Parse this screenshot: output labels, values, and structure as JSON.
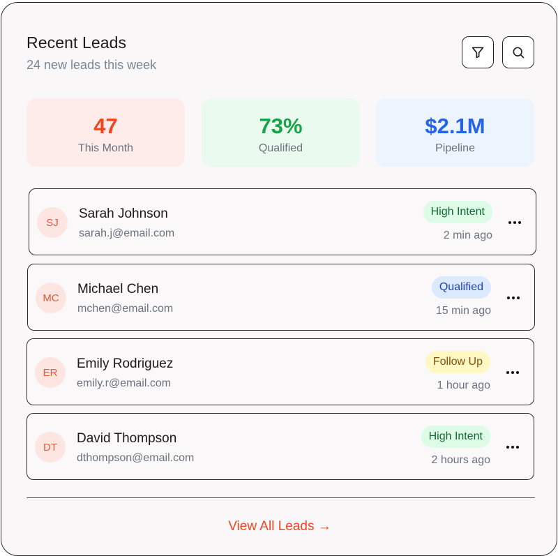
{
  "header": {
    "title": "Recent Leads",
    "subtitle": "24 new leads this week",
    "filter_icon": "filter-icon",
    "search_icon": "search-icon"
  },
  "stats": [
    {
      "value": "47",
      "label": "This Month",
      "color": "#f0451f"
    },
    {
      "value": "73%",
      "label": "Qualified",
      "color": "#19a34a"
    },
    {
      "value": "$2.1M",
      "label": "Pipeline",
      "color": "#2563eb"
    }
  ],
  "leads": [
    {
      "initials": "SJ",
      "name": "Sarah Johnson",
      "email": "sarah.j@email.com",
      "badge": "High Intent",
      "time": "2 min ago"
    },
    {
      "initials": "MC",
      "name": "Michael Chen",
      "email": "mchen@email.com",
      "badge": "Qualified",
      "time": "15 min ago"
    },
    {
      "initials": "ER",
      "name": "Emily Rodriguez",
      "email": "emily.r@email.com",
      "badge": "Follow Up",
      "time": "1 hour ago"
    },
    {
      "initials": "DT",
      "name": "David Thompson",
      "email": "dthompson@email.com",
      "badge": "High Intent",
      "time": "2 hours ago"
    }
  ],
  "footer": {
    "view_all": "View All Leads →"
  },
  "colors": {
    "accent": "#f0451f",
    "high_intent_bg": "#dcfce7",
    "qualified_bg": "#dbeafe",
    "follow_up_bg": "#fef9c3"
  }
}
